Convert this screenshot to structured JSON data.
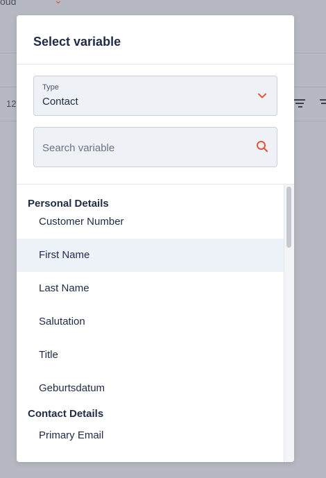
{
  "background": {
    "top_text": "oud",
    "row_number": "12"
  },
  "modal": {
    "title": "Select variable",
    "type_select": {
      "label": "Type",
      "value": "Contact"
    },
    "search": {
      "placeholder": "Search variable",
      "value": ""
    },
    "groups": [
      {
        "name": "Personal Details",
        "items": [
          "Customer Number",
          "First Name",
          "Last Name",
          "Salutation",
          "Title",
          "Geburtsdatum"
        ]
      },
      {
        "name": "Contact Details",
        "items": [
          "Primary Email"
        ]
      }
    ],
    "highlighted_item": "First Name"
  },
  "colors": {
    "accent": "#e0573b",
    "text": "#1f2a44",
    "highlight": "#edf1f8",
    "overlay": "#b6b9c2"
  },
  "icons": {
    "type_select": "chevron-down-icon",
    "search": "search-icon",
    "background_filter": "filter-icon"
  }
}
